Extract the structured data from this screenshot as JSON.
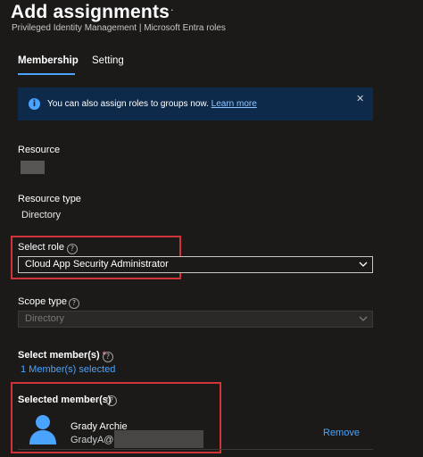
{
  "header": {
    "title": "Add assignments",
    "more_label": "···",
    "breadcrumb": "Privileged Identity Management | Microsoft Entra roles"
  },
  "tabs": [
    {
      "label": "Membership",
      "active": true
    },
    {
      "label": "Setting",
      "active": false
    }
  ],
  "banner": {
    "text": "You can also assign roles to groups now.",
    "link": "Learn more",
    "close": "✕"
  },
  "resource": {
    "label": "Resource",
    "value": ""
  },
  "resource_type": {
    "label": "Resource type",
    "value": "Directory"
  },
  "select_role": {
    "label": "Select role",
    "value": "Cloud App Security Administrator"
  },
  "scope_type": {
    "label": "Scope type",
    "value": "Directory",
    "disabled": true
  },
  "select_members": {
    "label": "Select member(s)",
    "required_mark": "*",
    "link": "1 Member(s) selected"
  },
  "selected_members": {
    "label": "Selected member(s)",
    "items": [
      {
        "name": "Grady Archie",
        "email": "GradyA@",
        "remove_label": "Remove"
      }
    ]
  },
  "colors": {
    "accent": "#4aa3ff",
    "highlight": "#d13438",
    "banner_bg": "#0e2a4a",
    "background": "#1b1a19"
  },
  "icons": [
    "more-icon",
    "info-icon",
    "close-icon",
    "help-icon",
    "chevron-down-icon",
    "user-avatar-icon"
  ]
}
